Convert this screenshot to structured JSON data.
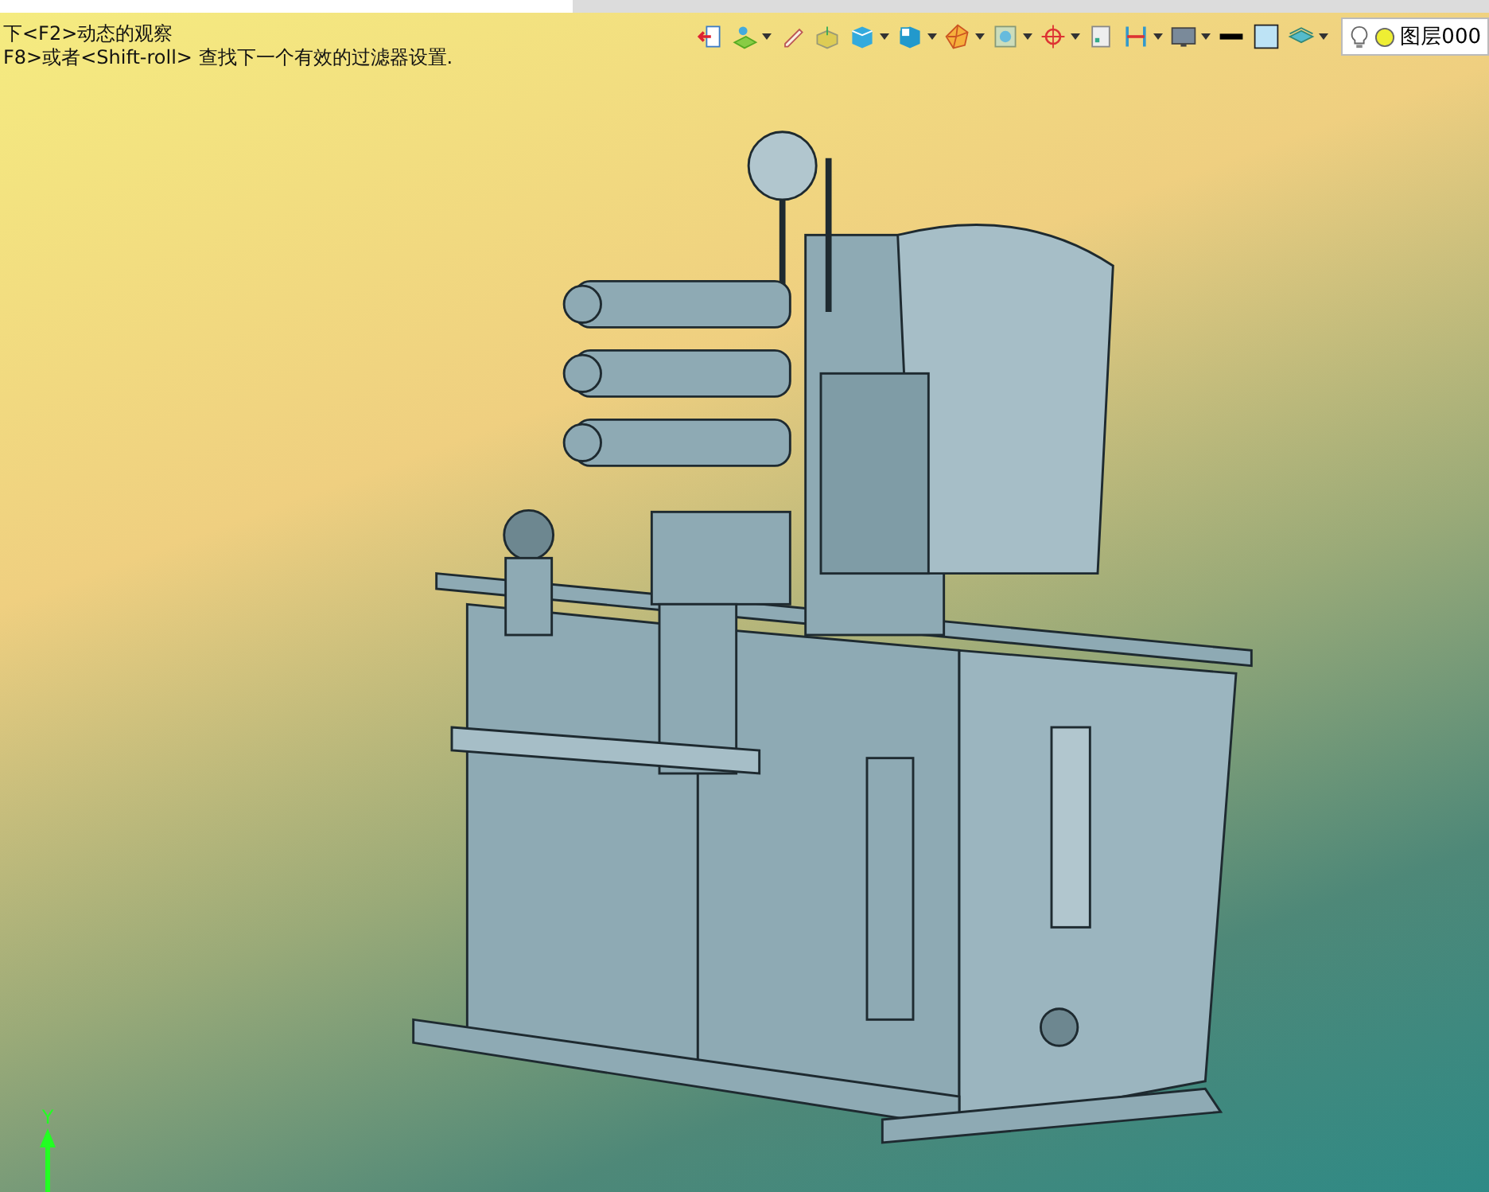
{
  "hints": [
    "下<F2>动态的观察",
    "F8>或者<Shift-roll> 查找下一个有效的过滤器设置."
  ],
  "toolbar": [
    {
      "kind": "exit",
      "dropdown": false
    },
    {
      "kind": "sketch",
      "dropdown": true
    },
    {
      "kind": "pencil",
      "dropdown": false
    },
    {
      "kind": "extrude",
      "dropdown": false
    },
    {
      "kind": "cube",
      "dropdown": true
    },
    {
      "kind": "viewcube",
      "dropdown": true
    },
    {
      "kind": "mesh",
      "dropdown": true
    },
    {
      "kind": "frame",
      "dropdown": true
    },
    {
      "kind": "target",
      "dropdown": true
    },
    {
      "kind": "panel",
      "dropdown": false
    },
    {
      "kind": "dimension",
      "dropdown": true
    },
    {
      "kind": "monitor",
      "dropdown": true
    },
    {
      "kind": "line",
      "dropdown": false
    },
    {
      "kind": "fill",
      "dropdown": false
    },
    {
      "kind": "layers",
      "dropdown": true
    }
  ],
  "layer_field": {
    "value": "图层000"
  },
  "axis": {
    "label": "Y"
  }
}
